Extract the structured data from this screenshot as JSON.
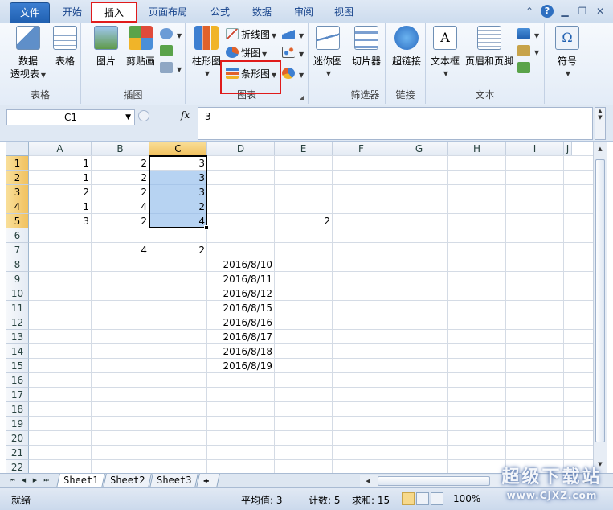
{
  "tabs": [
    "文件",
    "开始",
    "插入",
    "页面布局",
    "公式",
    "数据",
    "审阅",
    "视图"
  ],
  "ribbon": {
    "groups": {
      "tables": "表格",
      "illustrations": "插图",
      "charts": "图表",
      "sparklines": "",
      "filter": "筛选器",
      "links": "链接",
      "text": "文本",
      "symbols": ""
    },
    "buttons": {
      "pivot_line1": "数据",
      "pivot_line2": "透视表",
      "table": "表格",
      "picture": "图片",
      "clipart": "剪贴画",
      "column_chart": "柱形图",
      "line_chart": "折线图",
      "pie_chart": "饼图",
      "bar_chart": "条形图",
      "sparkline": "迷你图",
      "slicer": "切片器",
      "hyperlink": "超链接",
      "textbox": "文本框",
      "header_footer": "页眉和页脚",
      "symbol": "符号"
    }
  },
  "formula": {
    "name_box": "C1",
    "fx": "fx",
    "value": "3"
  },
  "grid": {
    "columns": [
      "A",
      "B",
      "C",
      "D",
      "E",
      "F",
      "G",
      "H",
      "I",
      "J"
    ],
    "rows": [
      "1",
      "2",
      "3",
      "4",
      "5",
      "6",
      "7",
      "8",
      "9",
      "10",
      "11",
      "12",
      "13",
      "14",
      "15",
      "16",
      "17",
      "18",
      "19",
      "20",
      "21",
      "22"
    ],
    "cells": {
      "A1": "1",
      "B1": "2",
      "C1": "3",
      "A2": "1",
      "B2": "2",
      "C2": "3",
      "A3": "2",
      "B3": "2",
      "C3": "3",
      "A4": "1",
      "B4": "4",
      "C4": "2",
      "A5": "3",
      "B5": "2",
      "C5": "4",
      "E5": "2",
      "B7": "4",
      "C7": "2",
      "D8": "2016/8/10",
      "D9": "2016/8/11",
      "D10": "2016/8/12",
      "D11": "2016/8/15",
      "D12": "2016/8/16",
      "D13": "2016/8/17",
      "D14": "2016/8/18",
      "D15": "2016/8/19"
    }
  },
  "sheets": [
    "Sheet1",
    "Sheet2",
    "Sheet3"
  ],
  "status": {
    "ready": "就绪",
    "average": "平均值: 3",
    "count": "计数: 5",
    "sum": "求和: 15",
    "zoom": "100%"
  },
  "watermark": {
    "title": "超级下载站",
    "url": "www.CJXZ.com"
  },
  "colors": {
    "accent_red": "#e01b1b",
    "selection": "#90bbeb",
    "file_tab": "#2a6bc0"
  }
}
